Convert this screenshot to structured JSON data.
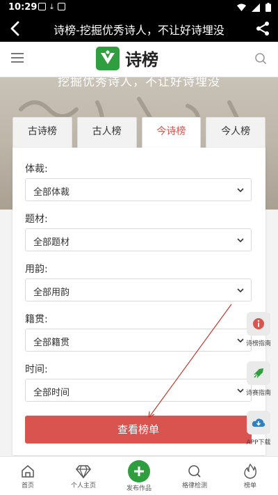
{
  "status_bar": {
    "time": "10:29"
  },
  "app_bar": {
    "title": "诗榜-挖掘优秀诗人，不让好诗埋没"
  },
  "site": {
    "logo_text": "诗榜",
    "slogan": "挖掘优秀诗人，不让好诗埋没"
  },
  "tabs": [
    {
      "label": "古诗榜",
      "active": false
    },
    {
      "label": "古人榜",
      "active": false
    },
    {
      "label": "今诗榜",
      "active": true
    },
    {
      "label": "今人榜",
      "active": false
    }
  ],
  "filters": [
    {
      "label": "体裁:",
      "value": "全部体裁"
    },
    {
      "label": "题材:",
      "value": "全部题材"
    },
    {
      "label": "用韵:",
      "value": "全部用韵"
    },
    {
      "label": "籍贯:",
      "value": "全部籍贯"
    },
    {
      "label": "时间:",
      "value": "全部时间"
    }
  ],
  "submit_label": "查看榜单",
  "floating": [
    {
      "label": "诗榜指南",
      "icon": "info-icon",
      "color": "#d9534f"
    },
    {
      "label": "诗赛指南",
      "icon": "rocket-icon",
      "color": "#2e9e3f"
    },
    {
      "label": "APP下载",
      "icon": "cloud-download-icon",
      "color": "#2f7fc1"
    }
  ],
  "bottom_nav": [
    {
      "label": "首页",
      "icon": "home-icon"
    },
    {
      "label": "个人主页",
      "icon": "diamond-icon"
    },
    {
      "label": "发布作品",
      "icon": "plus-icon"
    },
    {
      "label": "格律检测",
      "icon": "search-icon"
    },
    {
      "label": "榜单",
      "icon": "flame-icon"
    }
  ],
  "colors": {
    "accent": "#d9534f",
    "brand": "#2e9e3f",
    "bar": "#000000"
  }
}
